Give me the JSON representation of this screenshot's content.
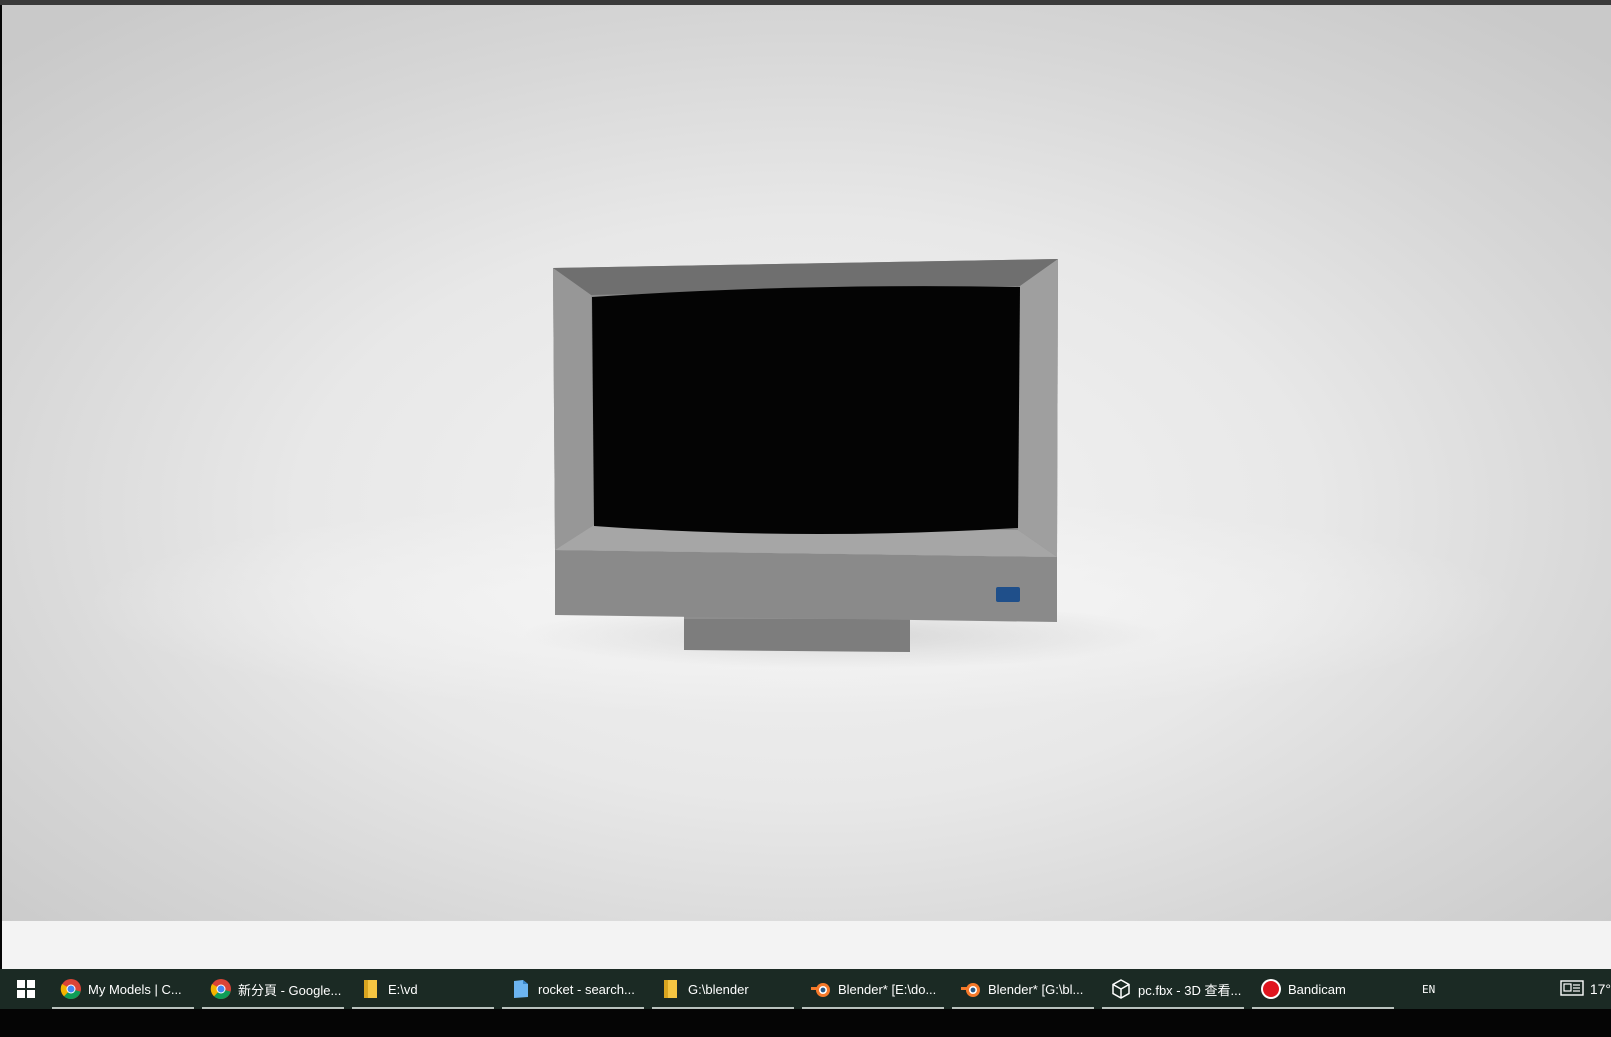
{
  "viewer": {
    "background": "#e6e6e6",
    "model": "computer monitor"
  },
  "taskbar": {
    "background": "#1b2a24",
    "items": [
      {
        "icon": "chrome-icon",
        "label": "My Models | C..."
      },
      {
        "icon": "chrome-icon",
        "label": "新分頁 - Google..."
      },
      {
        "icon": "folder-icon",
        "label": "E:\\vd"
      },
      {
        "icon": "file-icon",
        "label": "rocket - search..."
      },
      {
        "icon": "folder-icon",
        "label": "G:\\blender"
      },
      {
        "icon": "blender-icon",
        "label": "Blender* [E:\\do..."
      },
      {
        "icon": "blender-icon",
        "label": "Blender* [G:\\bl..."
      },
      {
        "icon": "3d-viewer-icon",
        "label": "pc.fbx - 3D 查看..."
      },
      {
        "icon": "bandicam-icon",
        "label": "Bandicam"
      }
    ],
    "language": "EN",
    "temperature": "17°"
  }
}
